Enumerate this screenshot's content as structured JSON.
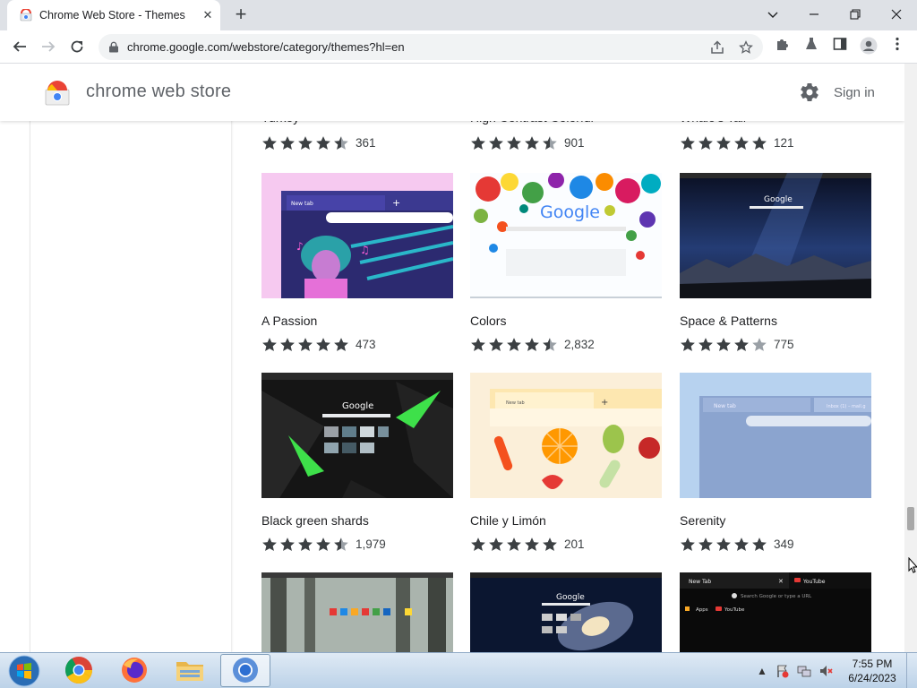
{
  "browser": {
    "tab_title": "Chrome Web Store - Themes",
    "tab_close": "✕",
    "new_tab": "+",
    "url": "chrome.google.com/webstore/category/themes?hl=en",
    "window_controls": [
      "chevron-down-icon",
      "minimize-icon",
      "restore-icon",
      "close-icon"
    ]
  },
  "store": {
    "title": "chrome web store",
    "sign_in": "Sign in"
  },
  "themes": [
    {
      "name": "Turkey",
      "rating": 4.5,
      "reviews": "361"
    },
    {
      "name": "High Contrast Colorful",
      "rating": 4.5,
      "reviews": "901"
    },
    {
      "name": "Whale's Tail",
      "rating": 5,
      "reviews": "121"
    },
    {
      "name": "A Passion",
      "rating": 5,
      "reviews": "473"
    },
    {
      "name": "Colors",
      "rating": 4.5,
      "reviews": "2,832"
    },
    {
      "name": "Space & Patterns",
      "rating": 4,
      "reviews": "775"
    },
    {
      "name": "Black green shards",
      "rating": 4.5,
      "reviews": "1,979"
    },
    {
      "name": "Chile y Limón",
      "rating": 5,
      "reviews": "201"
    },
    {
      "name": "Serenity",
      "rating": 5,
      "reviews": "349"
    },
    {
      "name": "",
      "rating": null,
      "reviews": ""
    },
    {
      "name": "",
      "rating": null,
      "reviews": ""
    },
    {
      "name": "",
      "rating": null,
      "reviews": ""
    }
  ],
  "thumb_text": {
    "new_tab": "New tab",
    "google": "Google",
    "youtube": "YouTube",
    "inbox": "Inbox (1) – mail.g",
    "search_placeholder": "Search Google or type a URL",
    "apps": "Apps",
    "new_tab_caps": "New Tab"
  },
  "taskbar": {
    "time": "7:55 PM",
    "date": "6/24/2023",
    "apps": [
      "chrome-icon",
      "firefox-icon",
      "file-explorer-icon",
      "chromium-icon"
    ]
  },
  "colors": {
    "accent": "#1a73e8",
    "star": "#3c4043",
    "star_empty": "#9aa0a6"
  }
}
